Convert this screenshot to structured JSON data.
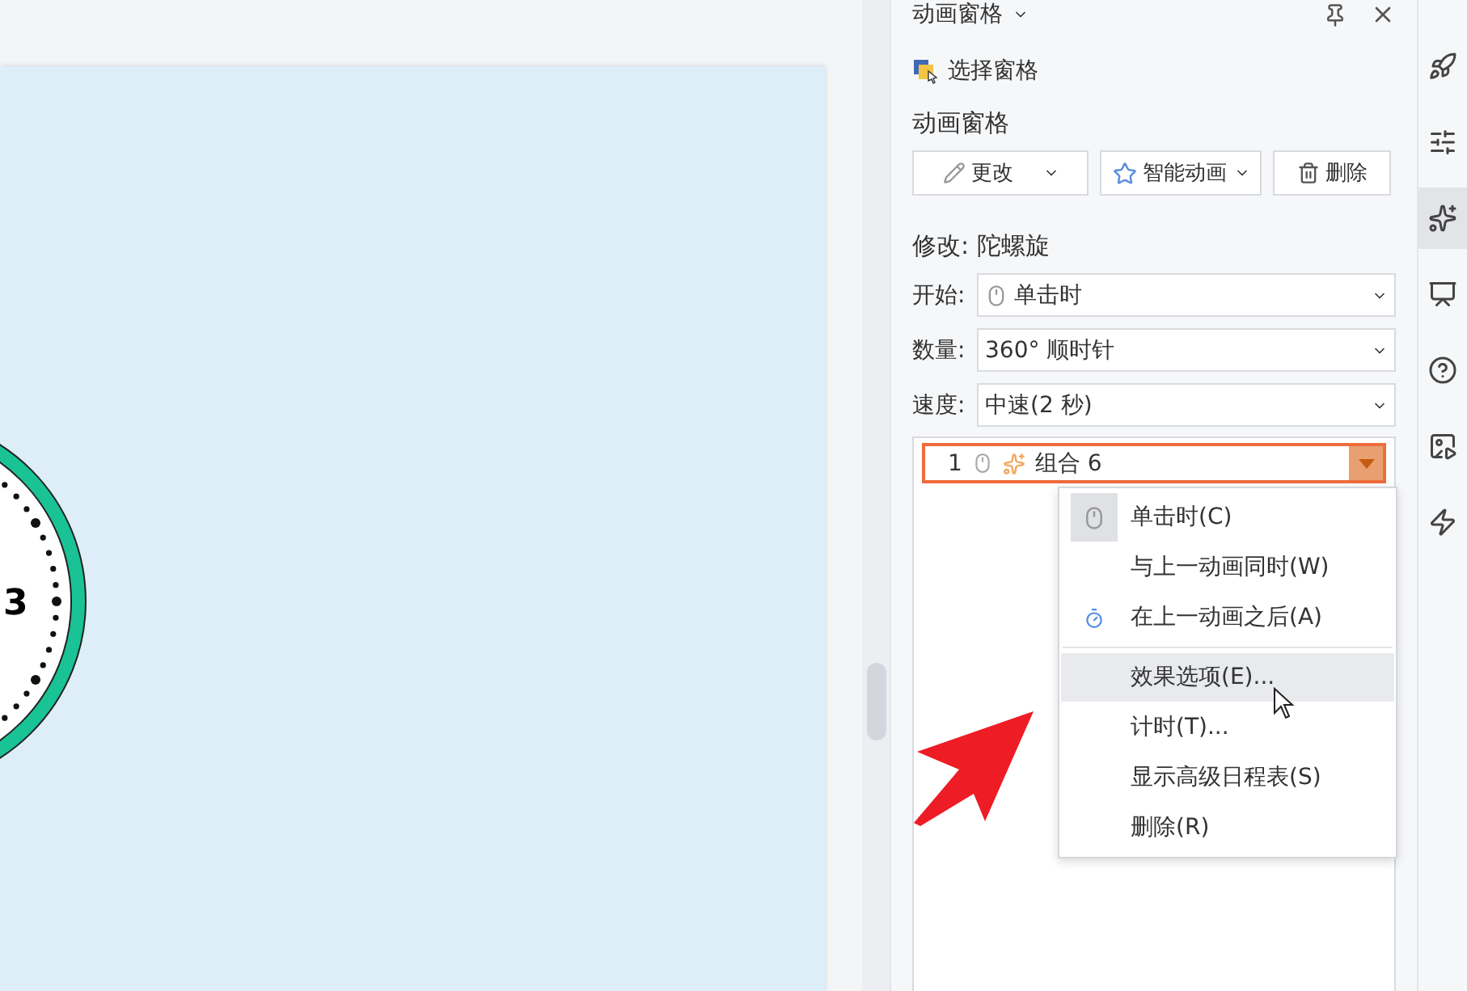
{
  "panel": {
    "title": "动画窗格",
    "selection_pane": "选择窗格",
    "section_title": "动画窗格",
    "buttons": [
      {
        "kind": "change",
        "label": "更改"
      },
      {
        "kind": "smart",
        "label": "智能动画"
      },
      {
        "kind": "delete",
        "label": "删除"
      }
    ],
    "modify_label": "修改: 陀螺旋",
    "fields": [
      {
        "label": "开始:",
        "value": "单击时",
        "mouse_icon": true
      },
      {
        "label": "数量:",
        "value": "360° 顺时针",
        "mouse_icon": false
      },
      {
        "label": "速度:",
        "value": "中速(2 秒)",
        "mouse_icon": false
      }
    ],
    "animations": [
      {
        "number": "1",
        "name": "组合 6",
        "selected": true
      }
    ]
  },
  "context_menu": {
    "sections": [
      [
        {
          "kind": "on_click",
          "label": "单击时(C)",
          "checked": true,
          "highlighted": false
        },
        {
          "kind": "with_previous",
          "label": "与上一动画同时(W)",
          "checked": false,
          "highlighted": false
        },
        {
          "kind": "after_previous",
          "label": "在上一动画之后(A)",
          "checked": false,
          "highlighted": false
        }
      ],
      [
        {
          "kind": "command",
          "label": "效果选项(E)...",
          "highlighted": true
        },
        {
          "kind": "command",
          "label": "计时(T)...",
          "highlighted": false
        },
        {
          "kind": "command",
          "label": "显示高级日程表(S)",
          "highlighted": false
        },
        {
          "kind": "command",
          "label": "删除(R)",
          "highlighted": false
        }
      ]
    ]
  },
  "slide": {
    "clock_numeral": "3"
  },
  "sidebar_tools": [
    {
      "selected": false
    },
    {
      "selected": false
    },
    {
      "selected": true
    },
    {
      "selected": false
    },
    {
      "selected": false
    },
    {
      "selected": false
    },
    {
      "selected": false
    }
  ]
}
